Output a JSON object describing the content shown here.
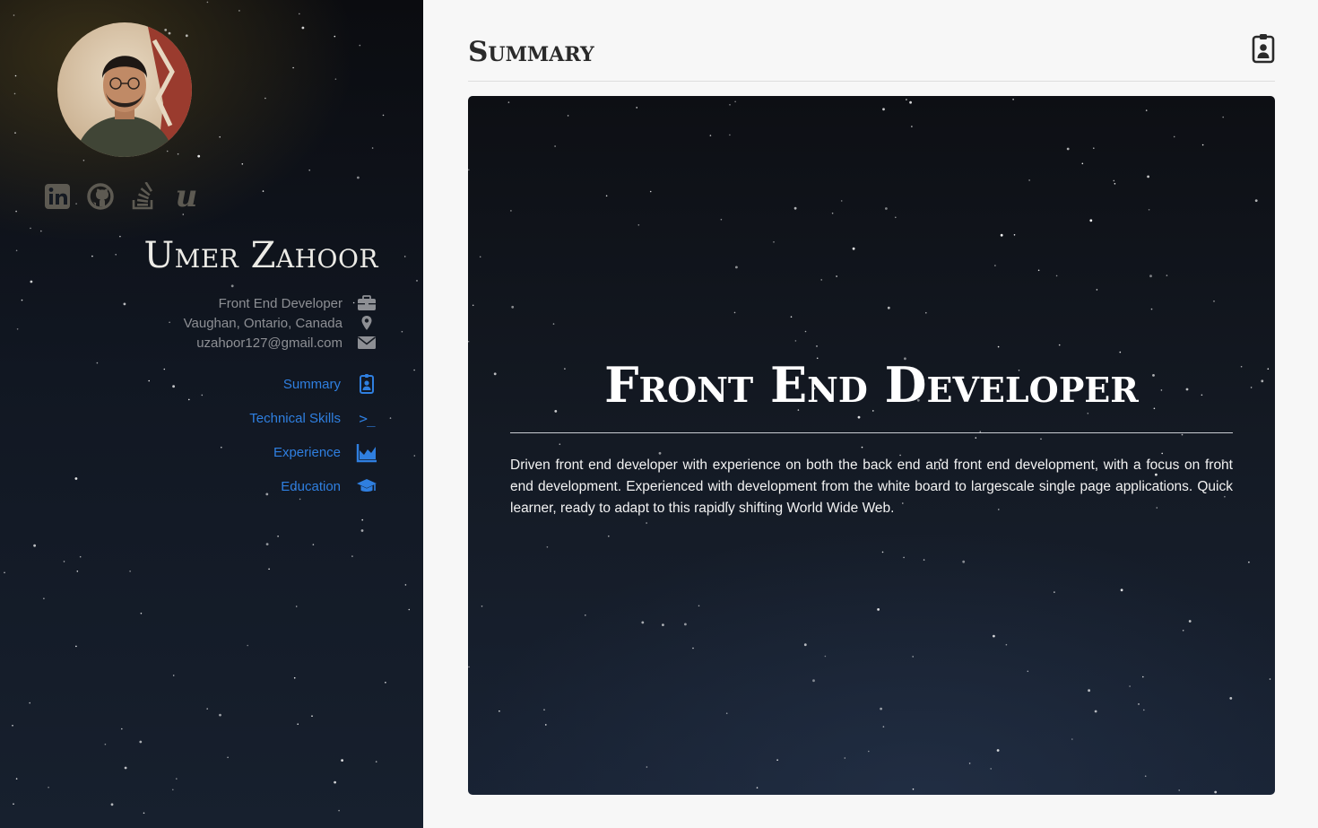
{
  "sidebar": {
    "name": "Umer Zahoor",
    "socials": [
      {
        "icon": "linkedin-icon"
      },
      {
        "icon": "github-icon"
      },
      {
        "icon": "stackoverflow-icon"
      },
      {
        "icon": "upwork-icon"
      }
    ],
    "info": {
      "title": "Front End Developer",
      "location": "Vaughan, Ontario, Canada",
      "email": "uzahoor127@gmail.com"
    },
    "nav": [
      {
        "label": "Summary",
        "icon": "contact-badge-icon"
      },
      {
        "label": "Technical Skills",
        "icon": "terminal-icon"
      },
      {
        "label": "Experience",
        "icon": "chart-area-icon"
      },
      {
        "label": "Education",
        "icon": "graduation-cap-icon"
      }
    ]
  },
  "main": {
    "page_title": "Summary",
    "header_icon": "contact-badge-icon",
    "hero": {
      "title": "Front End Developer",
      "description": "Driven front end developer with experience on both the back end and front end development, with a focus on front end development. Experienced with development from the white board to largescale single page applications. Quick learner, ready to adapt to this rapidly shifting World Wide Web."
    }
  },
  "colors": {
    "accent": "#2f7fe0",
    "sidebar_bg": "#111722",
    "main_bg": "#f7f7f7",
    "muted_icon": "#5d5a52",
    "info_text": "#8d8f94"
  }
}
